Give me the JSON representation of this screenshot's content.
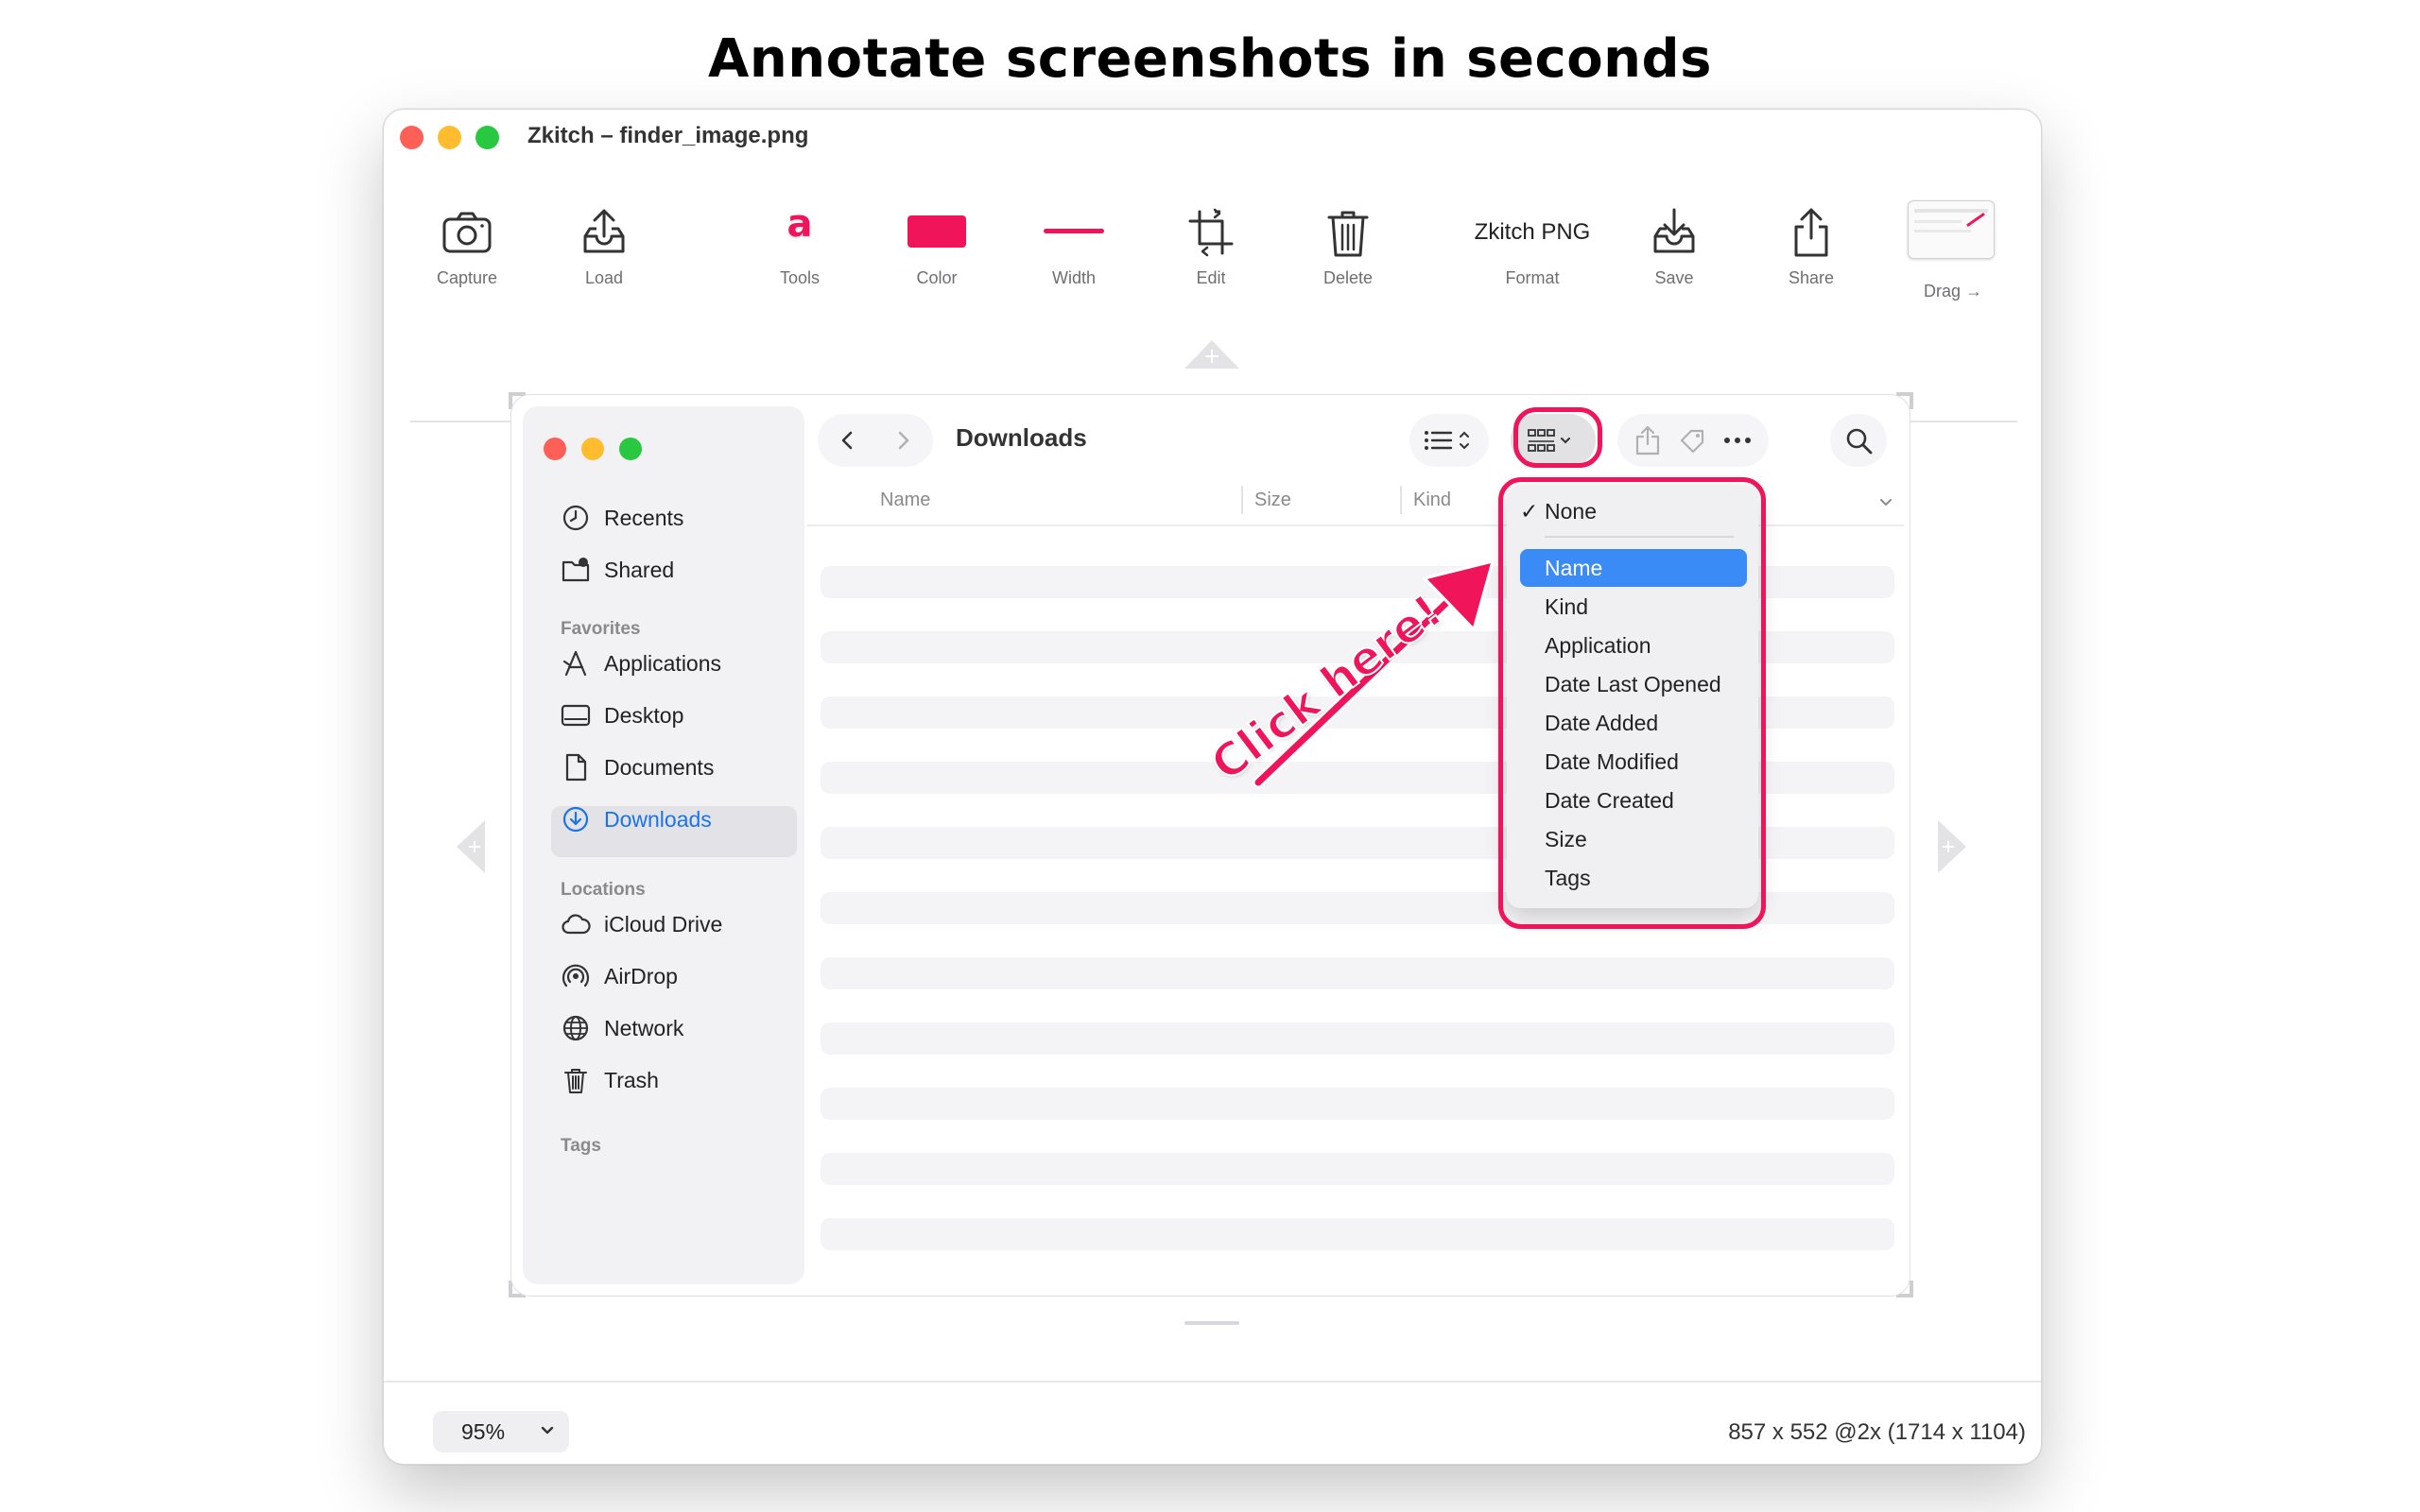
{
  "headline": "Annotate screenshots in seconds",
  "window": {
    "title": "Zkitch – finder_image.png"
  },
  "toolbar": {
    "capture": "Capture",
    "load": "Load",
    "tools": "Tools",
    "tools_glyph": "a",
    "color": "Color",
    "width": "Width",
    "edit": "Edit",
    "delete": "Delete",
    "format_value": "Zkitch PNG",
    "format": "Format",
    "save": "Save",
    "share": "Share",
    "drag": "Drag →",
    "accent_color": "#f0145a"
  },
  "footer": {
    "zoom": "95%",
    "dimensions": "857 x 552 @2x (1714 x 1104)"
  },
  "finder": {
    "title": "Downloads",
    "sidebar": {
      "top_items": [
        {
          "label": "Recents",
          "icon": "clock-icon"
        },
        {
          "label": "Shared",
          "icon": "shared-folder-icon"
        }
      ],
      "favorites_heading": "Favorites",
      "favorites": [
        {
          "label": "Applications",
          "icon": "applications-icon"
        },
        {
          "label": "Desktop",
          "icon": "desktop-icon"
        },
        {
          "label": "Documents",
          "icon": "document-icon"
        },
        {
          "label": "Downloads",
          "icon": "download-icon"
        }
      ],
      "locations_heading": "Locations",
      "locations": [
        {
          "label": "iCloud Drive",
          "icon": "cloud-icon"
        },
        {
          "label": "AirDrop",
          "icon": "airdrop-icon"
        },
        {
          "label": "Network",
          "icon": "globe-icon"
        },
        {
          "label": "Trash",
          "icon": "trash-icon"
        }
      ],
      "tags_heading": "Tags"
    },
    "columns": [
      "Name",
      "Size",
      "Kind"
    ],
    "group_menu": {
      "checked": "None",
      "check_mark": "✓",
      "items": [
        "Name",
        "Kind",
        "Application",
        "Date Last Opened",
        "Date Added",
        "Date Modified",
        "Date Created",
        "Size",
        "Tags"
      ],
      "highlighted": "Name"
    },
    "highlight_color": "#3b8bf7"
  },
  "annotation": {
    "text": "Click here!",
    "color": "#f0145a"
  }
}
